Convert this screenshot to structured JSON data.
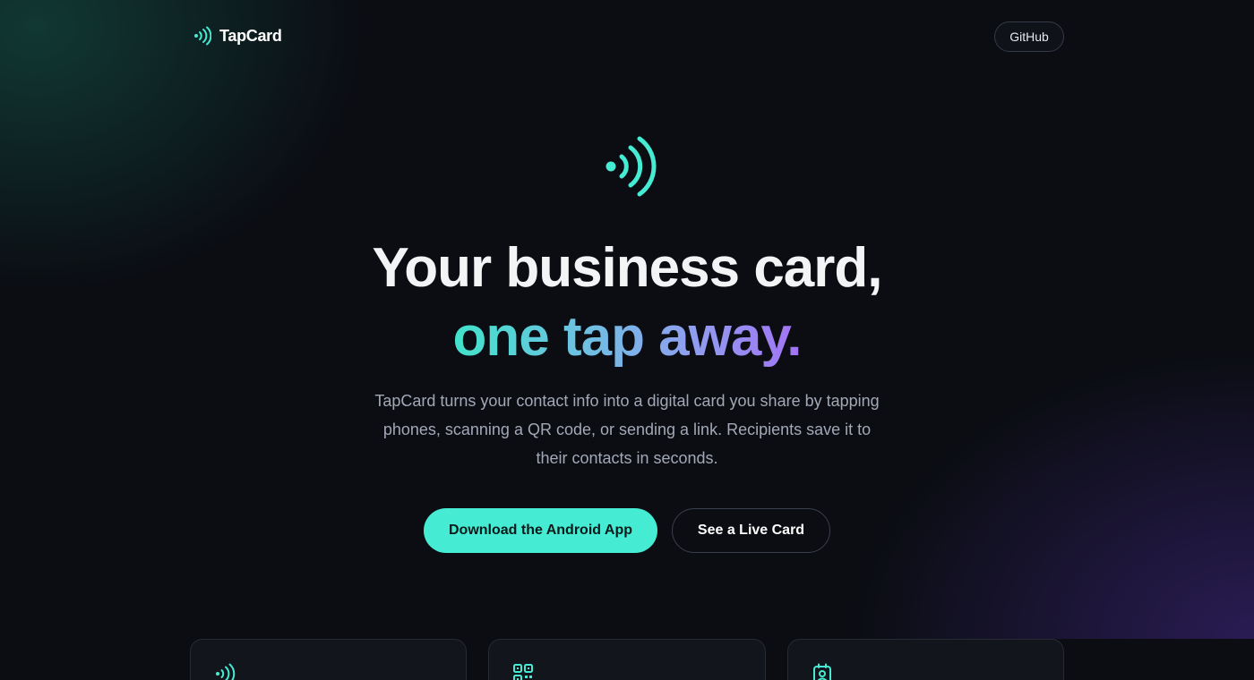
{
  "nav": {
    "brand": "TapCard",
    "brand_icon": "nfc-waves-icon",
    "github_label": "GitHub"
  },
  "hero": {
    "icon": "nfc-waves-icon",
    "headline_line1": "Your business card,",
    "headline_line2": "one tap away.",
    "subtitle": "TapCard turns your contact info into a digital card you share by tapping phones, scanning a QR code, or sending a link. Recipients save it to their contacts in seconds.",
    "primary_cta": "Download the Android App",
    "secondary_cta": "See a Live Card"
  },
  "features": [
    {
      "icon": "nfc-waves-icon"
    },
    {
      "icon": "qr-code-icon"
    },
    {
      "icon": "contact-badge-icon"
    }
  ],
  "colors": {
    "background": "#0b0d13",
    "accent_teal": "#45ebd2",
    "accent_purple": "#a373f4",
    "text_muted": "#a3a8b6"
  }
}
